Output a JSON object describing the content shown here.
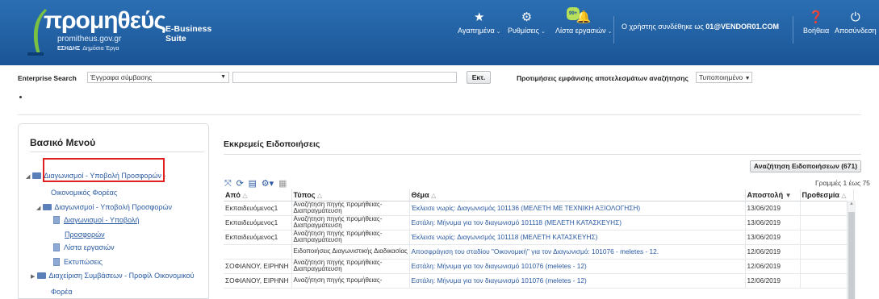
{
  "header": {
    "logo_main": "προμηθεύς",
    "logo_suite": "E-Business Suite",
    "logo_url": "promitheus.gov.gr",
    "logo_tag_bold": "ΕΣΗΔΗΣ",
    "logo_tag": "Δημόσια Έργα",
    "favorites_label": "Αγαπημένα",
    "settings_label": "Ρυθμίσεις",
    "worklist_label": "Λίστα εργασιών",
    "worklist_badge": "99+",
    "user_prefix": "Ο χρήστης συνδέθηκε ως",
    "user_name": "01@VENDOR01.COM",
    "help_label": "Βοήθεια",
    "logout_label": "Αποσύνδεση",
    "colors": {
      "header_bg": "#1f5fa5",
      "link": "#2a5aa2",
      "highlight": "#e0201f"
    }
  },
  "search": {
    "label": "Enterprise Search",
    "select_value": "Έγγραφα σύμβασης",
    "query": "",
    "go_label": "Εκτ.",
    "pref_label": "Προτιμήσεις εμφάνισης αποτελεσμάτων αναζήτησης",
    "pref_value": "Τυποποιημένο"
  },
  "menu": {
    "title": "Βασικό Μενού",
    "items": [
      {
        "label": "Διαγωνισμοί - Υποβολή Προσφορών -"
      },
      {
        "label": "Οικονομικός Φορέας"
      },
      {
        "label": "Διαγωνισμοί - Υποβολή Προσφορών"
      },
      {
        "label": "Διαγωνισμοί - Υποβολή"
      },
      {
        "label": "Προσφορών"
      },
      {
        "label": "Λίστα εργασιών"
      },
      {
        "label": "Εκτυπώσεις"
      },
      {
        "label": "Διαχείριση Συμβάσεων - Προφίλ Οικονομικού"
      },
      {
        "label": "Φορέα"
      }
    ]
  },
  "notifications": {
    "title": "Εκκρεμείς Ειδοποιήσεις",
    "search_button": "Αναζήτηση Ειδοποιήσεων (671)",
    "row_count": "Γραμμές 1 έως 75",
    "columns": {
      "from": "Από",
      "type": "Τύπος",
      "subject": "Θέμα",
      "sent": "Αποστολή",
      "deadline": "Προθεσμία"
    },
    "rows": [
      {
        "from": "Εκπαιδευόμενος1",
        "type": "Αναζήτηση πηγής προμήθειας-Διαπραγμάτευση",
        "subject": "Έκλεισε νωρίς: Διαγωνισμός 101136 (ΜΕΛΕΤΗ ΜΕ ΤΕΧΝΙΚΗ ΑΞΙΟΛΟΓΗΣΗ)",
        "sent": "13/06/2019",
        "deadline": ""
      },
      {
        "from": "Εκπαιδευόμενος1",
        "type": "Αναζήτηση πηγής προμήθειας-Διαπραγμάτευση",
        "subject": "Εστάλη: Μήνυμα για τον διαγωνισμό 101118 (ΜΕΛΕΤΗ ΚΑΤΑΣΚΕΥΗΣ)",
        "sent": "13/06/2019",
        "deadline": ""
      },
      {
        "from": "Εκπαιδευόμενος1",
        "type": "Αναζήτηση πηγής προμήθειας-Διαπραγμάτευση",
        "subject": "Έκλεισε νωρίς: Διαγωνισμός 101118 (ΜΕΛΕΤΗ ΚΑΤΑΣΚΕΥΗΣ)",
        "sent": "13/06/2019",
        "deadline": ""
      },
      {
        "from": "",
        "type": "Ειδοποιήσεις Διαγωνιστικής Διαδικασίας",
        "subject": "Αποσφράγιση του σταδίου \"Οικονομική\" για τον Διαγωνισμό: 101076 - meletes - 12.",
        "sent": "12/06/2019",
        "deadline": ""
      },
      {
        "from": "ΣΟΦΙΑΝΟΥ, ΕΙΡΗΝΗ",
        "type": "Αναζήτηση πηγής προμήθειας-Διαπραγμάτευση",
        "subject": "Εστάλη: Μήνυμα για τον διαγωνισμό 101076 (meletes - 12)",
        "sent": "12/06/2019",
        "deadline": ""
      },
      {
        "from": "ΣΟΦΙΑΝΟΥ, ΕΙΡΗΝΗ",
        "type": "Αναζήτηση πηγής προμήθειας-",
        "subject": "Εστάλη: Μήνυμα για τον διαγωνισμό 101076 (meletes - 12)",
        "sent": "12/06/2019",
        "deadline": ""
      }
    ]
  }
}
